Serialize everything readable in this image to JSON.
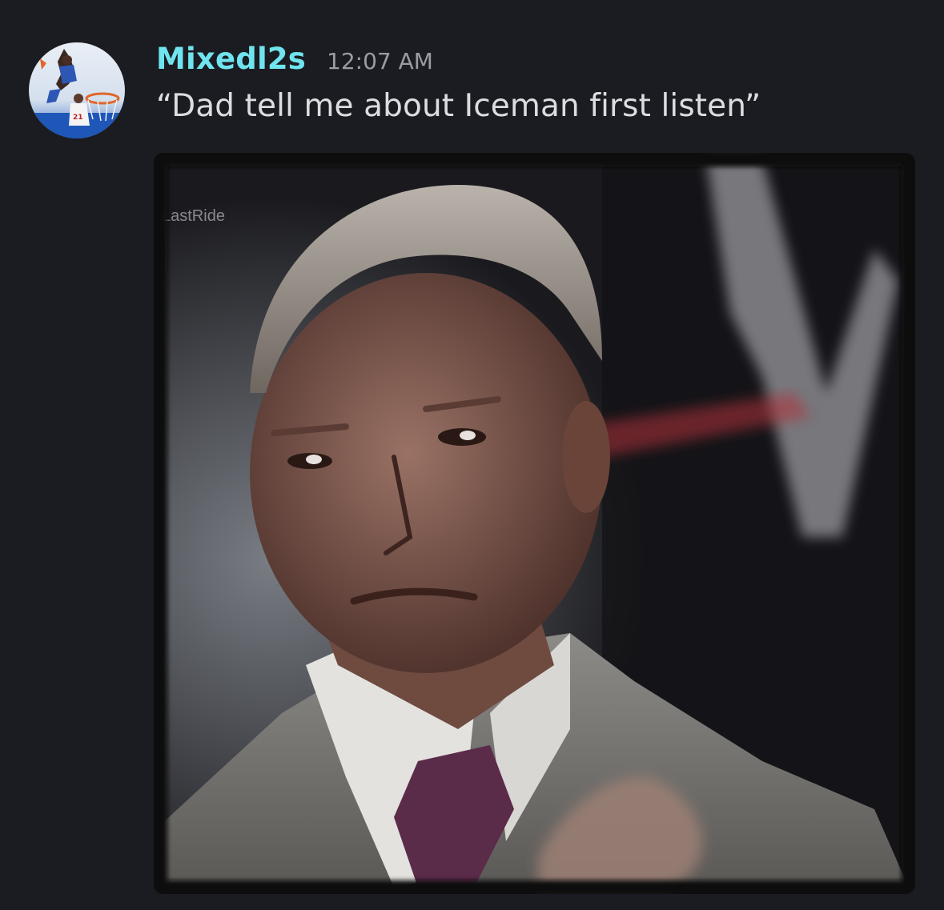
{
  "message": {
    "author": {
      "username": "Mixedl2s",
      "avatar_icon": "basketball-dunk-avatar",
      "name_color": "#70e4ee"
    },
    "timestamp": "12:07 AM",
    "text": "“Dad tell me about Iceman first listen”",
    "attachment": {
      "type": "image",
      "watermark_text": "LastRide"
    }
  },
  "theme": {
    "background": "#1b1c21",
    "text_color": "#dcdde1",
    "timestamp_color": "#9a9ca3"
  }
}
